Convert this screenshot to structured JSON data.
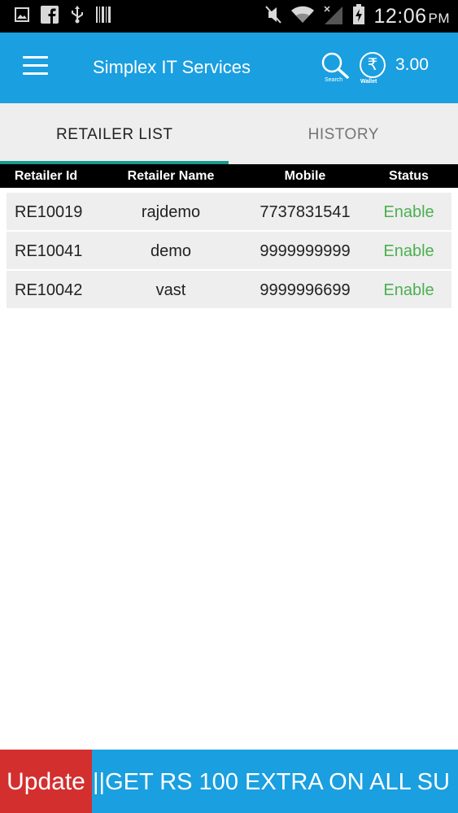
{
  "status_bar": {
    "time": "12:06",
    "ampm": "PM",
    "left_icons": [
      "gallery-icon",
      "facebook-icon",
      "usb-icon",
      "barcode-icon"
    ],
    "right_icons": [
      "mute-icon",
      "wifi-icon",
      "signal-icon",
      "battery-icon"
    ]
  },
  "app_bar": {
    "title": "Simplex IT Services",
    "search_caption": "Search",
    "wallet_symbol": "₹",
    "wallet_caption": "Wallet",
    "balance": "3.00"
  },
  "tabs": [
    {
      "label": "RETAILER LIST",
      "active": true
    },
    {
      "label": "HISTORY",
      "active": false
    }
  ],
  "table": {
    "headers": [
      "Retailer Id",
      "Retailer Name",
      "Mobile",
      "Status"
    ],
    "rows": [
      {
        "id": "RE10019",
        "name": "rajdemo",
        "mobile": "7737831541",
        "status": "Enable"
      },
      {
        "id": "RE10041",
        "name": "demo",
        "mobile": "9999999999",
        "status": "Enable"
      },
      {
        "id": "RE10042",
        "name": "vast",
        "mobile": "9999996699",
        "status": "Enable"
      }
    ]
  },
  "ticker": {
    "button_label": "Update",
    "message": "||GET RS 100 EXTRA  ON ALL SU"
  },
  "colors": {
    "primary": "#1a9fe0",
    "tab_indicator": "#1a9a8c",
    "status_enable": "#4caf50",
    "update_button": "#d32f2f"
  }
}
